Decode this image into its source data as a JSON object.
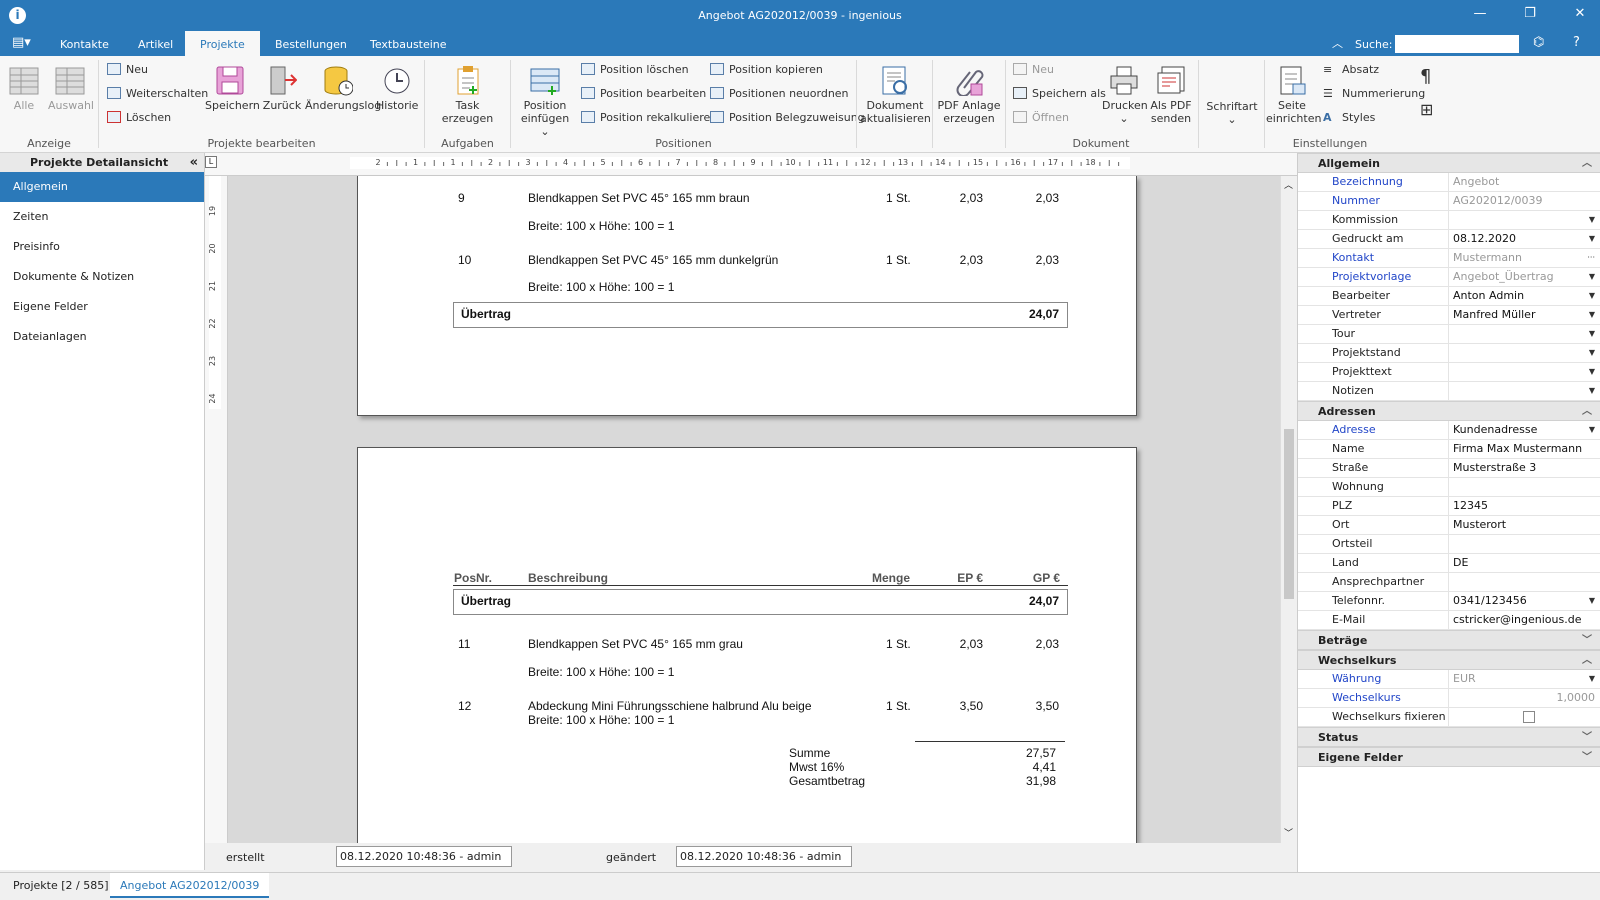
{
  "window": {
    "title": "Angebot AG202012/0039 - ingenious",
    "app_icon": "i"
  },
  "menu": {
    "tabs": [
      "Kontakte",
      "Artikel",
      "Projekte",
      "Bestellungen",
      "Textbausteine"
    ],
    "search_label": "Suche:",
    "search_value": ""
  },
  "ribbon": {
    "anzeige": {
      "label": "Anzeige",
      "alle": "Alle",
      "auswahl": "Auswahl"
    },
    "bearbeiten": {
      "label": "Projekte bearbeiten",
      "neu": "Neu",
      "weiterschalten": "Weiterschalten",
      "loeschen": "Löschen",
      "speichern": "Speichern",
      "zurueck": "Zurück",
      "aenderungslog": "Änderungslog",
      "historie": "Historie"
    },
    "aufgaben": {
      "label": "Aufgaben",
      "task": "Task erzeugen"
    },
    "positionen": {
      "label": "Positionen",
      "einfuegen_1": "Position",
      "einfuegen_2": "einfügen",
      "loeschen": "Position löschen",
      "bearbeiten": "Position bearbeiten",
      "rekalkulieren": "Position rekalkulieren",
      "kopieren": "Position kopieren",
      "neuordnen": "Positionen neuordnen",
      "beleg": "Position Belegzuweisung"
    },
    "dokument": {
      "label": "Dokument",
      "aktualisieren_1": "Dokument",
      "aktualisieren_2": "aktualisieren",
      "pdf_1": "PDF Anlage",
      "pdf_2": "erzeugen",
      "neu": "Neu",
      "speichern_als": "Speichern als",
      "oeffnen": "Öffnen",
      "drucken": "Drucken",
      "als_pdf_1": "Als PDF",
      "als_pdf_2": "senden"
    },
    "schriftart": "Schriftart",
    "einstellungen": {
      "label": "Einstellungen",
      "seite_1": "Seite",
      "seite_2": "einrichten",
      "absatz": "Absatz",
      "nummerierung": "Nummerierung",
      "styles": "Styles"
    }
  },
  "left_panel": {
    "title": "Projekte Detailansicht",
    "items": [
      "Allgemein",
      "Zeiten",
      "Preisinfo",
      "Dokumente & Notizen",
      "Eigene Felder",
      "Dateianlagen"
    ]
  },
  "rulers": {
    "h_ticks": [
      "2",
      "1",
      "1",
      "2",
      "3",
      "4",
      "5",
      "6",
      "7",
      "8",
      "9",
      "10",
      "11",
      "12",
      "13",
      "14",
      "15",
      "16",
      "17",
      "18"
    ],
    "v_ticks": [
      "19",
      "20",
      "21",
      "22",
      "23",
      "24"
    ]
  },
  "document": {
    "page1_rows": [
      {
        "pos": "9",
        "desc": "Blendkappen Set PVC 45° 165 mm braun",
        "menge": "1 St.",
        "ep": "2,03",
        "gp": "2,03",
        "sub": "Breite: 100 x Höhe: 100 = 1"
      },
      {
        "pos": "10",
        "desc": "Blendkappen Set PVC 45° 165 mm dunkelgrün",
        "menge": "1 St.",
        "ep": "2,03",
        "gp": "2,03",
        "sub": "Breite: 100 x Höhe: 100 = 1"
      }
    ],
    "uebertrag_label": "Übertrag",
    "uebertrag_value": "24,07",
    "table_headers": {
      "pos": "PosNr.",
      "desc": "Beschreibung",
      "menge": "Menge",
      "ep": "EP €",
      "gp": "GP €"
    },
    "page2_rows": [
      {
        "pos": "11",
        "desc": "Blendkappen Set PVC 45° 165 mm grau",
        "menge": "1 St.",
        "ep": "2,03",
        "gp": "2,03",
        "sub": "Breite: 100 x Höhe: 100 = 1"
      },
      {
        "pos": "12",
        "desc": "Abdeckung Mini Führungsschiene halbrund Alu beige",
        "menge": "1 St.",
        "ep": "3,50",
        "gp": "3,50",
        "sub": "Breite: 100 x Höhe: 100 = 1"
      }
    ],
    "totals": [
      {
        "label": "Summe",
        "value": "27,57"
      },
      {
        "label": "Mwst 16%",
        "value": "4,41"
      },
      {
        "label": "Gesamtbetrag",
        "value": "31,98"
      }
    ]
  },
  "footer": {
    "erstellt_label": "erstellt",
    "erstellt_value": "08.12.2020 10:48:36 - admin",
    "geaendert_label": "geändert",
    "geaendert_value": "08.12.2020 10:48:36 - admin"
  },
  "status_tabs": [
    "Projekte [2 / 585]",
    "Angebot AG202012/0039"
  ],
  "properties": {
    "allgemein": {
      "title": "Allgemein",
      "rows": [
        {
          "label": "Bezeichnung",
          "value": "Angebot",
          "link": true,
          "disabled": true,
          "dd": false
        },
        {
          "label": "Nummer",
          "value": "AG202012/0039",
          "link": true,
          "disabled": true,
          "dd": false
        },
        {
          "label": "Kommission",
          "value": "",
          "link": false,
          "disabled": false,
          "dd": true
        },
        {
          "label": "Gedruckt am",
          "value": "08.12.2020",
          "link": false,
          "disabled": false,
          "dd": true
        },
        {
          "label": "Kontakt",
          "value": "Mustermann",
          "link": true,
          "disabled": true,
          "dd": false,
          "more": true
        },
        {
          "label": "Projektvorlage",
          "value": "Angebot_Übertrag",
          "link": true,
          "disabled": true,
          "dd": true
        },
        {
          "label": "Bearbeiter",
          "value": "Anton Admin",
          "link": false,
          "disabled": false,
          "dd": true
        },
        {
          "label": "Vertreter",
          "value": "Manfred Müller",
          "link": false,
          "disabled": false,
          "dd": true
        },
        {
          "label": "Tour",
          "value": "",
          "link": false,
          "disabled": false,
          "dd": true
        },
        {
          "label": "Projektstand",
          "value": "",
          "link": false,
          "disabled": false,
          "dd": true
        },
        {
          "label": "Projekttext",
          "value": "",
          "link": false,
          "disabled": false,
          "dd": true
        },
        {
          "label": "Notizen",
          "value": "",
          "link": false,
          "disabled": false,
          "dd": true
        }
      ]
    },
    "adressen": {
      "title": "Adressen",
      "rows": [
        {
          "label": "Adresse",
          "value": "Kundenadresse",
          "link": true,
          "disabled": false,
          "dd": true
        },
        {
          "label": "Name",
          "value": "Firma Max Mustermann",
          "link": false,
          "disabled": false,
          "dd": false
        },
        {
          "label": "Straße",
          "value": "Musterstraße 3",
          "link": false,
          "disabled": false,
          "dd": false
        },
        {
          "label": "Wohnung",
          "value": "",
          "link": false,
          "disabled": false,
          "dd": false
        },
        {
          "label": "PLZ",
          "value": "12345",
          "link": false,
          "disabled": false,
          "dd": false
        },
        {
          "label": "Ort",
          "value": "Musterort",
          "link": false,
          "disabled": false,
          "dd": false
        },
        {
          "label": "Ortsteil",
          "value": "",
          "link": false,
          "disabled": false,
          "dd": false
        },
        {
          "label": "Land",
          "value": "DE",
          "link": false,
          "disabled": false,
          "dd": false
        },
        {
          "label": "Ansprechpartner",
          "value": "",
          "link": false,
          "disabled": false,
          "dd": false
        },
        {
          "label": "Telefonnr.",
          "value": "0341/123456",
          "link": false,
          "disabled": false,
          "dd": true
        },
        {
          "label": "E-Mail",
          "value": "cstricker@ingenious.de",
          "link": false,
          "disabled": false,
          "dd": false
        }
      ]
    },
    "betraege": {
      "title": "Beträge"
    },
    "wechselkurs": {
      "title": "Wechselkurs",
      "waehrung_label": "Währung",
      "waehrung_value": "EUR",
      "kurs_label": "Wechselkurs",
      "kurs_value": "1,0000",
      "fix_label": "Wechselkurs fixieren",
      "fix_checked": false
    },
    "status": {
      "title": "Status"
    },
    "eigene": {
      "title": "Eigene Felder"
    }
  }
}
